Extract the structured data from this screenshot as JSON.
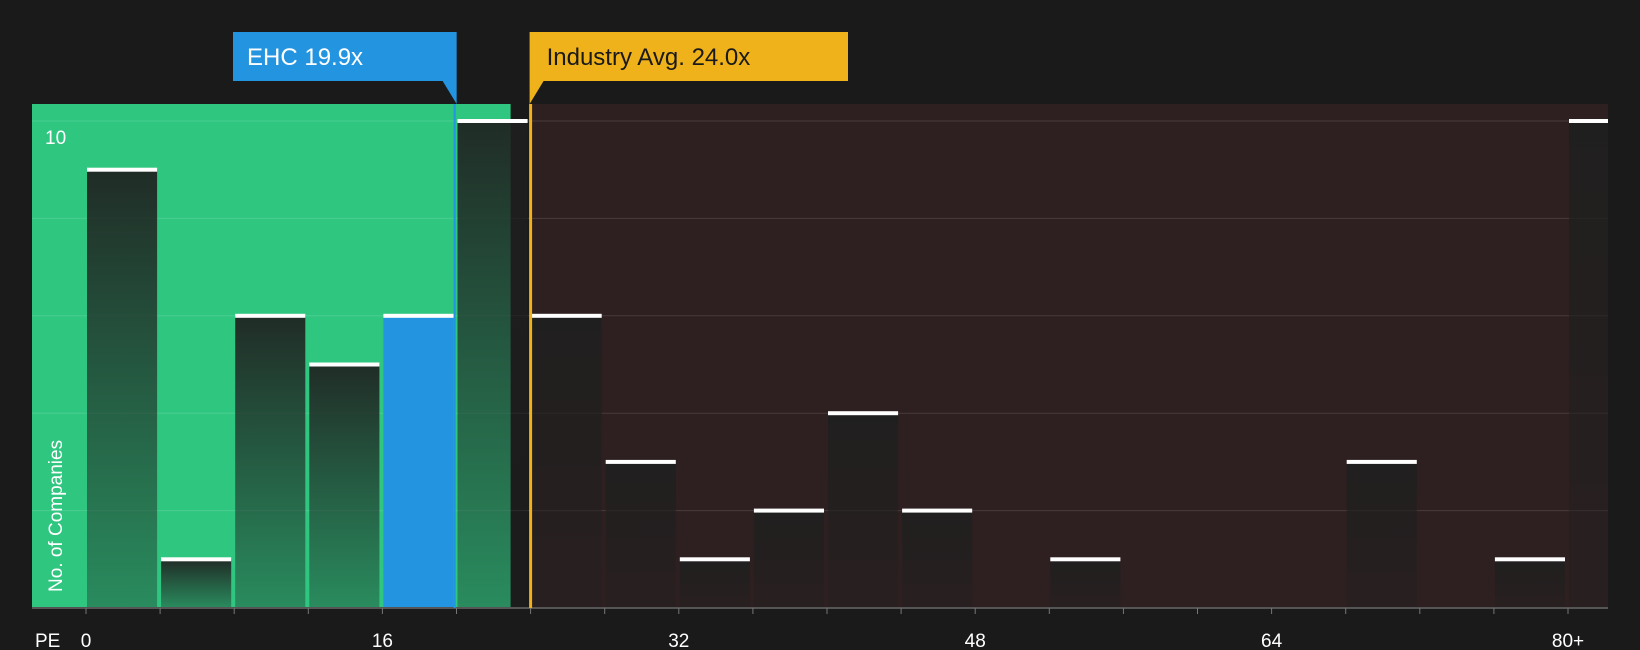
{
  "chart_data": {
    "type": "bar",
    "title": "",
    "xlabel": "PE",
    "ylabel": "No. of Companies",
    "x_ticks": [
      "0",
      "16",
      "32",
      "48",
      "64",
      "80+"
    ],
    "y_tick_labels": [
      "10"
    ],
    "ylim": [
      0,
      10
    ],
    "grid": true,
    "bin_width": 4,
    "bins": [
      {
        "start": 0,
        "value": 9
      },
      {
        "start": 4,
        "value": 1
      },
      {
        "start": 8,
        "value": 6
      },
      {
        "start": 12,
        "value": 5
      },
      {
        "start": 16,
        "value": 6,
        "highlight": true
      },
      {
        "start": 20,
        "value": 10
      },
      {
        "start": 24,
        "value": 6
      },
      {
        "start": 28,
        "value": 3
      },
      {
        "start": 32,
        "value": 1
      },
      {
        "start": 36,
        "value": 2
      },
      {
        "start": 40,
        "value": 4
      },
      {
        "start": 44,
        "value": 2
      },
      {
        "start": 48,
        "value": 0
      },
      {
        "start": 52,
        "value": 1
      },
      {
        "start": 56,
        "value": 0
      },
      {
        "start": 60,
        "value": 0
      },
      {
        "start": 64,
        "value": 0
      },
      {
        "start": 68,
        "value": 3
      },
      {
        "start": 72,
        "value": 0
      },
      {
        "start": 76,
        "value": 1
      },
      {
        "start": 80,
        "value": 10
      }
    ],
    "company": {
      "ticker": "EHC",
      "value": 19.9,
      "label": "EHC 19.9x"
    },
    "industry": {
      "value": 24.0,
      "label": "Industry Avg. 24.0x"
    },
    "colors": {
      "background": "#1a1a1a",
      "undervalued_zone": "#2fc680",
      "overvalued_zone": "#2e1f20",
      "bar_default": "#232222",
      "bar_highlight": "#2394e0",
      "company_marker": "#2394e0",
      "industry_marker": "#f0b21b",
      "bar_cap": "#ffffff"
    }
  }
}
